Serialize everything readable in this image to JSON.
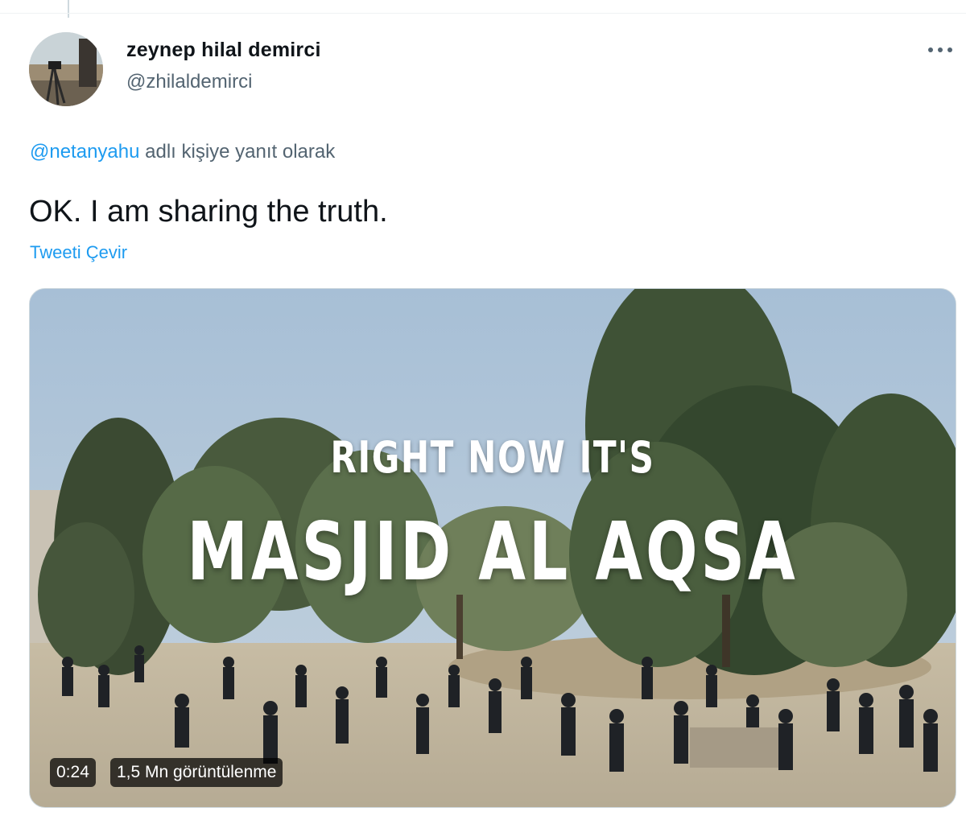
{
  "tweet": {
    "display_name": "zeynep hilal demirci",
    "handle": "@zhilaldemirci",
    "reply_mention": "@netanyahu",
    "reply_suffix": " adlı kişiye yanıt olarak",
    "text": "OK. I am sharing the truth.",
    "translate_label": "Tweeti Çevir"
  },
  "media": {
    "overlay_line1": "RIGHT NOW IT'S",
    "overlay_line2": "MASJID AL AQSA",
    "duration": "0:24",
    "views": "1,5 Mn görüntülenme"
  },
  "icons": {
    "more": "more-horizontal-icon",
    "avatar": "avatar"
  },
  "colors": {
    "accent": "#1d9bf0",
    "secondary_text": "#536471",
    "primary_text": "#0f1419"
  }
}
